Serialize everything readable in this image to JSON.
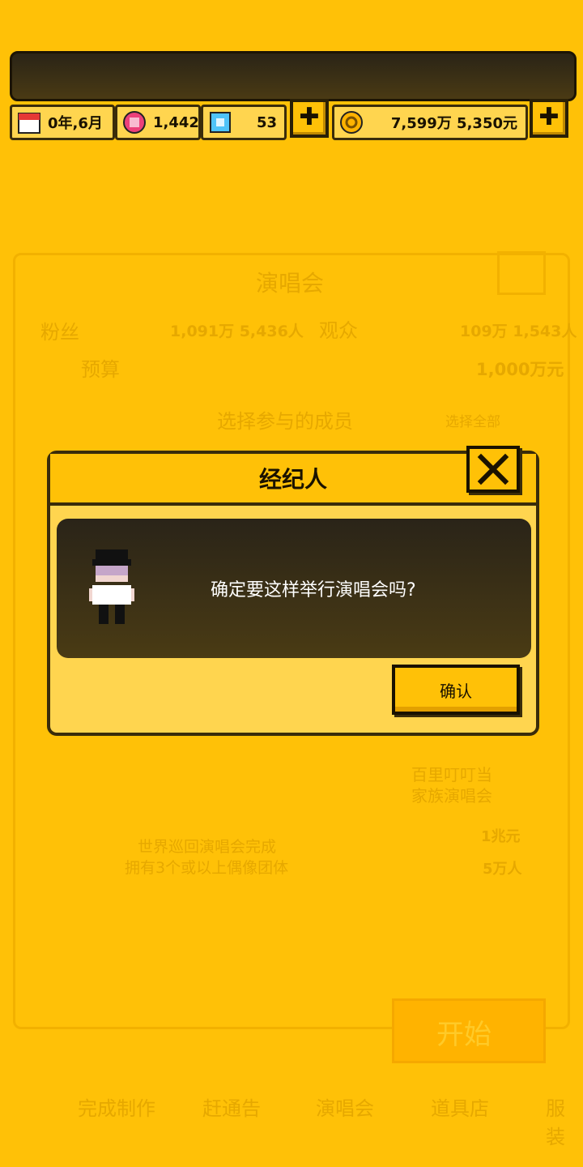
{
  "status_bar": {
    "date": "0年,6月",
    "gems": "1,442",
    "diamonds": "53",
    "money": "7,599万 5,350元",
    "plus": "✚"
  },
  "background": {
    "panel_title": "演唱会",
    "fans_label": "粉丝",
    "fans_value": "1,091万 5,436人",
    "audience_label": "观众",
    "audience_value": "109万 1,543人",
    "budget_label": "预算",
    "budget_value": "1,000万元",
    "select_members": "选择参与的成员",
    "select_all": "选择全部",
    "locked_line1": "世界巡回演唱会完成",
    "locked_line2": "拥有3个或以上偶像团体",
    "concert_name_line1": "百里叮叮当",
    "concert_name_line2": "家族演唱会",
    "concert_cost": "1兆元",
    "concert_audience": "5万人",
    "start_button": "开始",
    "bottom_tabs": [
      "完成制作",
      "赶通告",
      "演唱会",
      "道具店",
      "服装"
    ]
  },
  "dialog": {
    "title": "经纪人",
    "message": "确定要这样举行演唱会吗?",
    "confirm": "确认"
  }
}
